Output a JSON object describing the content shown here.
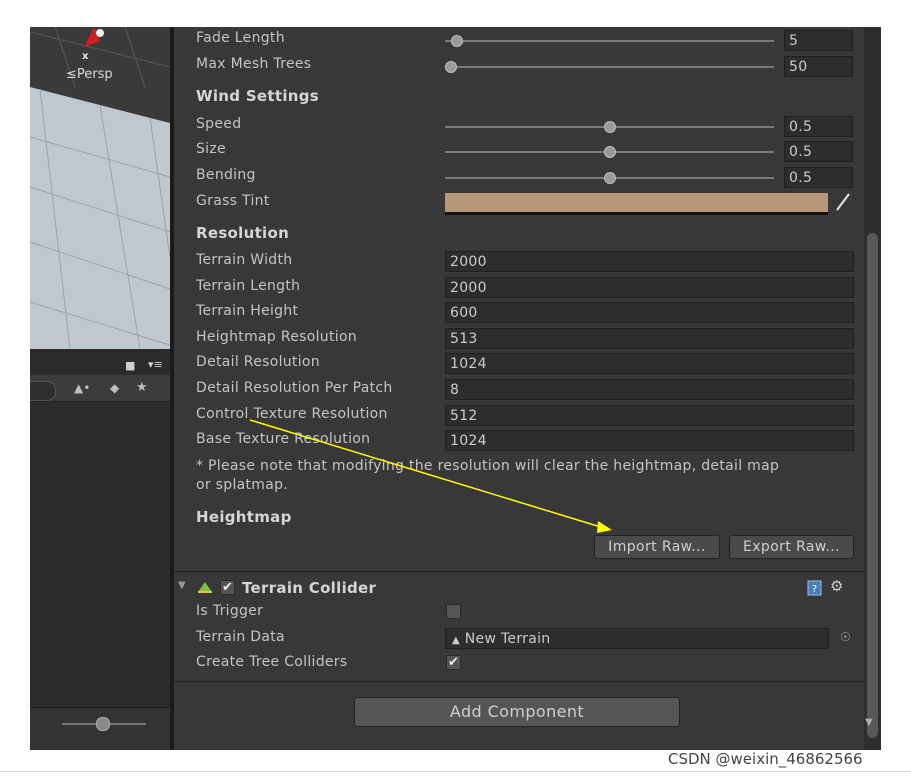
{
  "scene": {
    "persp_label": "≤Persp",
    "axis_label": "x"
  },
  "inspector": {
    "sliders": [
      {
        "label": "Fade Length",
        "value": "5",
        "fraction": 0.02
      },
      {
        "label": "Max Mesh Trees",
        "value": "50",
        "fraction": 0.0
      }
    ],
    "wind": {
      "heading": "Wind Settings",
      "sliders": [
        {
          "label": "Speed",
          "value": "0.5",
          "fraction": 0.5
        },
        {
          "label": "Size",
          "value": "0.5",
          "fraction": 0.5
        },
        {
          "label": "Bending",
          "value": "0.5",
          "fraction": 0.5
        }
      ],
      "grass_tint_label": "Grass Tint",
      "grass_tint_color": "#b8967a"
    },
    "resolution": {
      "heading": "Resolution",
      "fields": [
        {
          "label": "Terrain Width",
          "value": "2000"
        },
        {
          "label": "Terrain Length",
          "value": "2000"
        },
        {
          "label": "Terrain Height",
          "value": "600"
        },
        {
          "label": "Heightmap Resolution",
          "value": "513"
        },
        {
          "label": "Detail Resolution",
          "value": "1024"
        },
        {
          "label": "Detail Resolution Per Patch",
          "value": "8"
        },
        {
          "label": "Control Texture Resolution",
          "value": "512"
        },
        {
          "label": "Base Texture Resolution",
          "value": "1024"
        }
      ],
      "note_line1": "* Please note that modifying the resolution will clear the heightmap, detail map",
      "note_line2": "or splatmap."
    },
    "heightmap": {
      "heading": "Heightmap",
      "import_label": "Import Raw...",
      "export_label": "Export Raw..."
    },
    "collider": {
      "title": "Terrain Collider",
      "enabled": true,
      "is_trigger_label": "Is Trigger",
      "is_trigger": false,
      "terrain_data_label": "Terrain Data",
      "terrain_data_value": "New Terrain",
      "create_tree_colliders_label": "Create Tree Colliders",
      "create_tree_colliders": true
    },
    "add_component_label": "Add Component"
  },
  "annotation_arrow_color": "#ffff00",
  "watermark": "CSDN @weixin_46862566"
}
